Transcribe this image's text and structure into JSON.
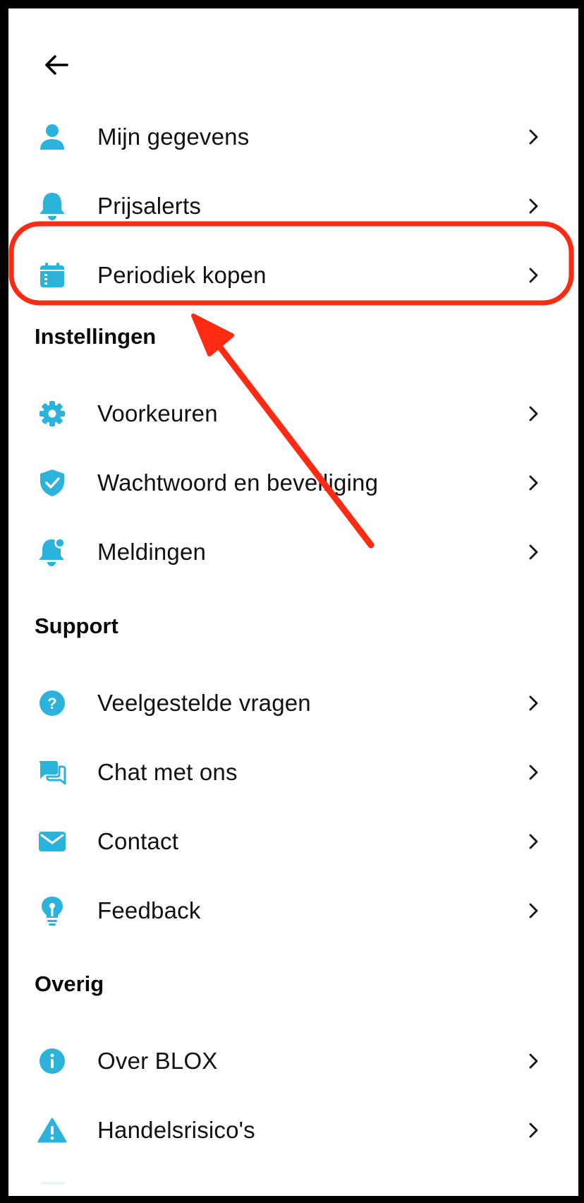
{
  "accent_color": "#2bb3dc",
  "annotation_color": "#ff2a12",
  "back_button": {
    "icon": "arrow-left-icon"
  },
  "account": [
    {
      "label": "Mijn gegevens",
      "icon": "user-icon"
    },
    {
      "label": "Prijsalerts",
      "icon": "bell-icon"
    },
    {
      "label": "Periodiek kopen",
      "icon": "calendar-icon"
    }
  ],
  "sections": {
    "instellingen": {
      "title": "Instellingen",
      "items": [
        {
          "label": "Voorkeuren",
          "icon": "gear-icon"
        },
        {
          "label": "Wachtwoord en beveiliging",
          "icon": "shield-check-icon"
        },
        {
          "label": "Meldingen",
          "icon": "notification-bell-icon"
        }
      ]
    },
    "support": {
      "title": "Support",
      "items": [
        {
          "label": "Veelgestelde vragen",
          "icon": "question-icon"
        },
        {
          "label": "Chat met ons",
          "icon": "chat-icon"
        },
        {
          "label": "Contact",
          "icon": "mail-icon"
        },
        {
          "label": "Feedback",
          "icon": "lightbulb-icon"
        }
      ]
    },
    "overig": {
      "title": "Overig",
      "items": [
        {
          "label": "Over BLOX",
          "icon": "info-icon"
        },
        {
          "label": "Handelsrisico's",
          "icon": "warning-icon"
        }
      ]
    }
  }
}
